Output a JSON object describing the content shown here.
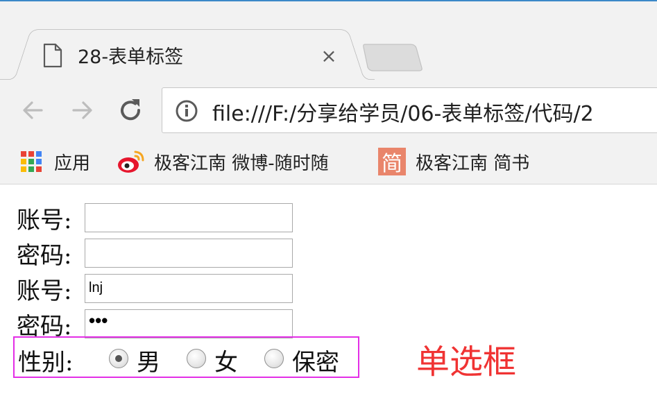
{
  "browser": {
    "tab_title": "28-表单标签",
    "tab_close": "×",
    "url": "file:///F:/分享给学员/06-表单标签/代码/2",
    "bookmarks": [
      {
        "label": "应用",
        "icon": "apps-grid-icon"
      },
      {
        "label": "极客江南 微博-随时随",
        "icon": "weibo-icon"
      },
      {
        "label": "极客江南 简书",
        "icon": "jianshu-icon",
        "icon_glyph": "简"
      }
    ],
    "colors": {
      "accent": "#3b88c8",
      "jianshu": "#e9856b",
      "weibo_red": "#e6162d"
    }
  },
  "form": {
    "rows": [
      {
        "label": "账号:",
        "value": ""
      },
      {
        "label": "密码:",
        "value": ""
      },
      {
        "label": "账号:",
        "value": "lnj"
      },
      {
        "label": "密码:",
        "value": "•••"
      }
    ],
    "gender": {
      "label": "性别:",
      "options": [
        {
          "label": "男",
          "checked": true
        },
        {
          "label": "女",
          "checked": false
        },
        {
          "label": "保密",
          "checked": false
        }
      ],
      "highlight_color": "#e32ee6"
    }
  },
  "annotation": {
    "text": "单选框",
    "color": "#f03333"
  }
}
